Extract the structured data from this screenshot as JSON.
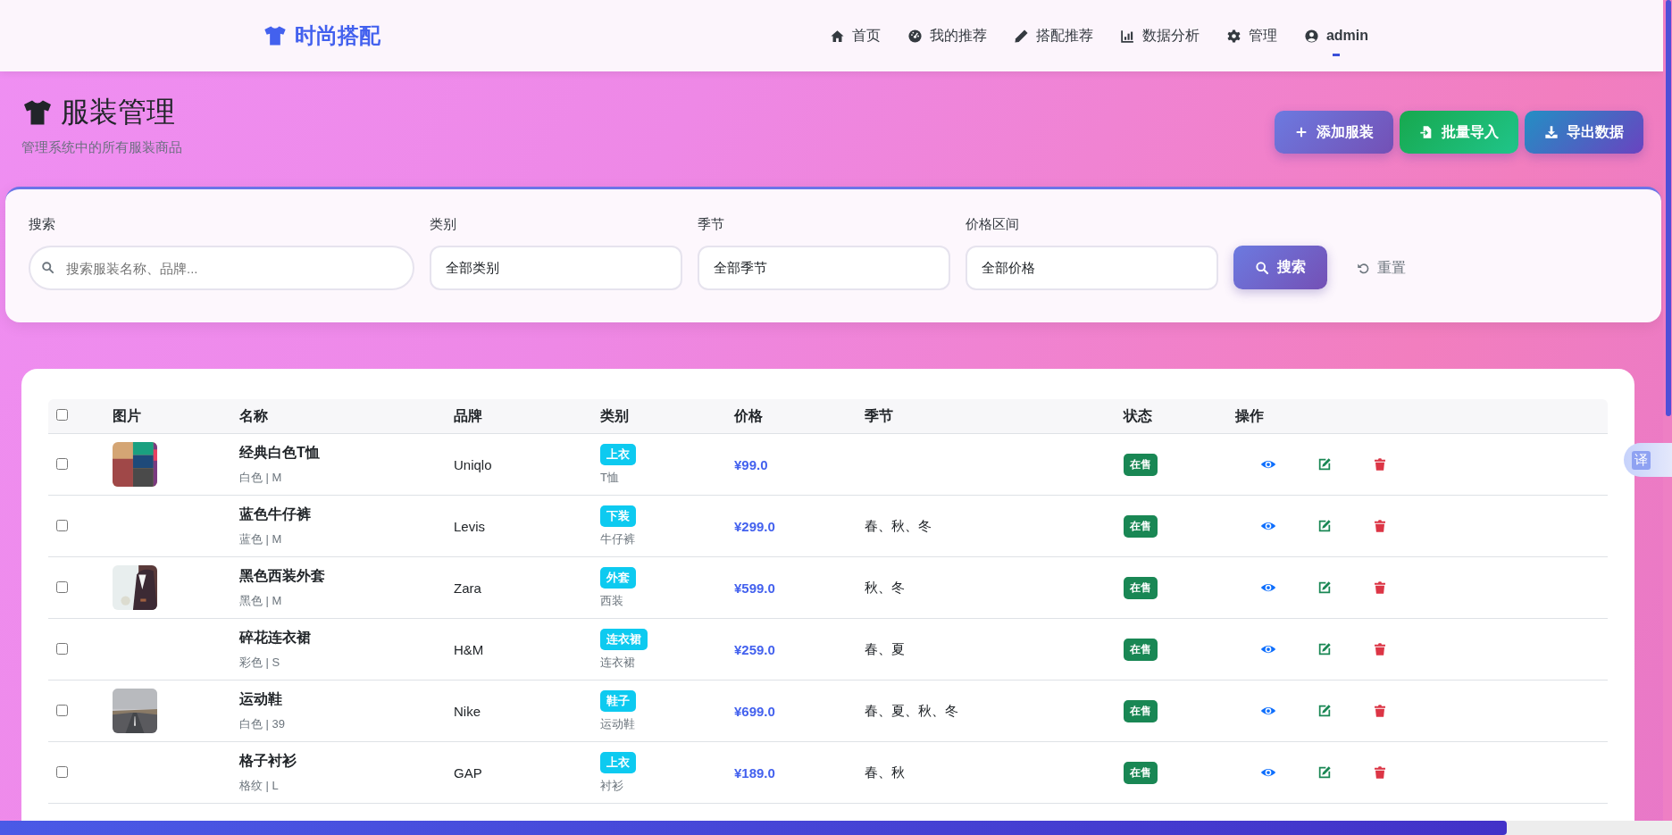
{
  "brand": {
    "name": "时尚搭配"
  },
  "nav": [
    {
      "label": "首页",
      "selected": false
    },
    {
      "label": "我的推荐",
      "selected": false
    },
    {
      "label": "搭配推荐",
      "selected": false
    },
    {
      "label": "数据分析",
      "selected": false
    },
    {
      "label": "管理",
      "selected": false
    },
    {
      "label": "admin",
      "selected": true
    }
  ],
  "header": {
    "title": "服装管理",
    "subtitle": "管理系统中的所有服装商品",
    "actions": [
      "添加服装",
      "批量导入",
      "导出数据"
    ]
  },
  "filters": {
    "search": {
      "label": "搜索",
      "placeholder": "搜索服装名称、品牌..."
    },
    "selects": [
      {
        "label": "类别",
        "value": "全部类别"
      },
      {
        "label": "季节",
        "value": "全部季节"
      },
      {
        "label": "价格区间",
        "value": "全部价格"
      }
    ],
    "search_button": "搜索",
    "reset_button": "重置"
  },
  "table": {
    "select_all_checked": false,
    "columns": [
      "图片",
      "名称",
      "品牌",
      "类别",
      "价格",
      "季节",
      "状态",
      "操作"
    ],
    "rows": [
      {
        "checked": false,
        "has_image": true,
        "name": "经典白色T恤",
        "detail": "白色 | M",
        "brand": "Uniqlo",
        "category": "上衣",
        "subcategory": "T恤",
        "price": "¥99.0",
        "status": "在售"
      },
      {
        "checked": false,
        "has_image": false,
        "name": "蓝色牛仔裤",
        "detail": "蓝色 | M",
        "brand": "Levis",
        "category": "下装",
        "subcategory": "牛仔裤",
        "price": "¥299.0",
        "season": "春、秋、冬",
        "status": "在售"
      },
      {
        "checked": false,
        "has_image": true,
        "name": "黑色西装外套",
        "detail": "黑色 | M",
        "brand": "Zara",
        "category": "外套",
        "subcategory": "西装",
        "price": "¥599.0",
        "season": "秋、冬",
        "status": "在售"
      },
      {
        "checked": false,
        "has_image": false,
        "name": "碎花连衣裙",
        "detail": "彩色 | S",
        "brand": "H&M",
        "category": "连衣裙",
        "subcategory": "连衣裙",
        "price": "¥259.0",
        "season": "春、夏",
        "status": "在售"
      },
      {
        "checked": false,
        "has_image": true,
        "name": "运动鞋",
        "detail": "白色 | 39",
        "brand": "Nike",
        "category": "鞋子",
        "subcategory": "运动鞋",
        "price": "¥699.0",
        "season": "春、夏、秋、冬",
        "status": "在售"
      },
      {
        "checked": false,
        "has_image": false,
        "name": "格子衬衫",
        "detail": "格纹 | L",
        "brand": "GAP",
        "category": "上衣",
        "subcategory": "衬衫",
        "price": "¥189.0",
        "season": "春、秋",
        "status": "在售"
      }
    ]
  },
  "translate_button": "译"
}
